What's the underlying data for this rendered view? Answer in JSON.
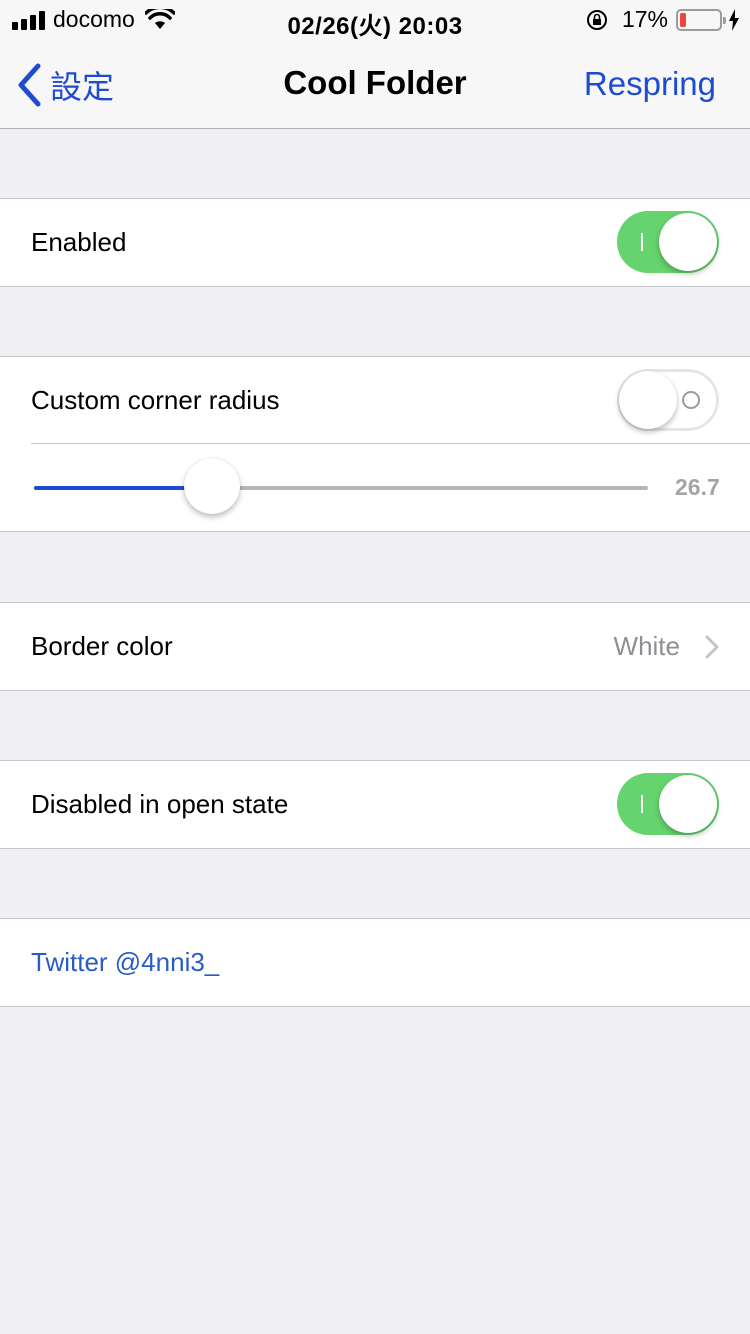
{
  "status_bar": {
    "carrier": "docomo",
    "time": "02/26(火) 20:03",
    "battery_percent": "17%",
    "battery_level": 0.17,
    "battery_color": "#e8473d"
  },
  "nav": {
    "back_label": "設定",
    "title": "Cool Folder",
    "right_button": "Respring",
    "accent_color": "#1f4bd1"
  },
  "settings": {
    "enabled": {
      "label": "Enabled",
      "value": true
    },
    "custom_corner_radius": {
      "label": "Custom corner radius",
      "value": false
    },
    "corner_radius_slider": {
      "value_label": "26.7",
      "fraction": 0.29
    },
    "border_color": {
      "label": "Border color",
      "value": "White"
    },
    "disabled_in_open_state": {
      "label": "Disabled in open state",
      "value": true
    },
    "twitter_link": {
      "label": "Twitter @4nni3_"
    }
  }
}
